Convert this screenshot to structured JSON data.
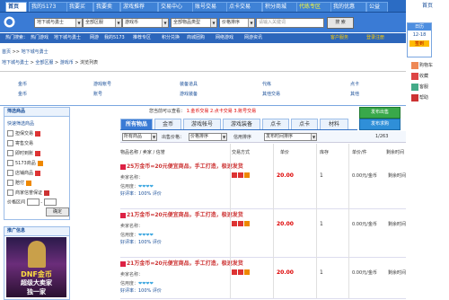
{
  "topnav": {
    "tabs": [
      {
        "label": "首页",
        "active": true
      },
      {
        "label": "我的5173"
      },
      {
        "label": "我要买"
      },
      {
        "label": "我要卖"
      },
      {
        "label": "游戏推荐"
      },
      {
        "label": "交易中心"
      },
      {
        "label": "账号交易"
      },
      {
        "label": "点卡交易"
      },
      {
        "label": "积分商城"
      },
      {
        "label": "代练专区"
      },
      {
        "label": "我的优惠"
      },
      {
        "label": "公益"
      }
    ],
    "right_label": "首页"
  },
  "search": {
    "game": "地下城与勇士",
    "server_type": "全部区服",
    "category": "游戏币",
    "sub_category": "全部物品类型",
    "sort": "价格排序",
    "keyword_placeholder": "请输入关键词",
    "button": "搜 索"
  },
  "sublinks": [
    "热门搜索：",
    "热门游戏",
    "地下城与勇士",
    "网游",
    "我的5173",
    "推荐专区",
    "积分兑换",
    "商城团购",
    "网络游戏",
    "网游资讯",
    "客户服务",
    "登录注册"
  ],
  "rightbar": {
    "calendar_top": "日历",
    "calendar_day": "12-18",
    "calendar_btn": "签到",
    "tools": [
      "购物车",
      "收藏",
      "客服",
      "帮助"
    ]
  },
  "breadcrumb": {
    "line1": [
      "首页",
      "地下城与勇士"
    ],
    "line2": [
      "地下城与勇士",
      "全部区服",
      "游戏币",
      "浏览列表"
    ]
  },
  "categories": [
    [
      "金币",
      "游戏帐号",
      "装备道具",
      "代练",
      "点卡"
    ],
    [
      "金币",
      "账号",
      "游戏装备",
      "其他交易",
      "其他"
    ]
  ],
  "leftpanel": {
    "title": "筛选商品",
    "subtitle": "快速筛选商品",
    "options": [
      "担保交易",
      "寄售交易",
      "即时到账",
      "5173商品",
      "店铺商品",
      "赔付",
      "商家信誉保证"
    ],
    "price_label": "价格区间",
    "price_sep": "-",
    "button": "确定"
  },
  "ad": {
    "title": "推广信息",
    "line1": "DNF金币",
    "line2": "超级大卖家",
    "line3": "独一家"
  },
  "main": {
    "notice_label": "您当前可以查看：",
    "notice_red": [
      "1.金币交易",
      "2.点卡交易",
      "3.账号交易"
    ],
    "publish_buttons": [
      "发布出售",
      "发布求购"
    ],
    "tabs": [
      "所有物品",
      "金币",
      "游戏帐号",
      "游戏装备",
      "点卡",
      "点卡",
      "材料"
    ],
    "filter": {
      "select1": "所有商品",
      "text1": "出售价格：",
      "select2": "价格排序",
      "text2": "信用排序",
      "select3": "发布时间排序",
      "page": "1/263"
    },
    "columns": [
      "物品名称 / 卖家 / 信誉",
      "交易方式",
      "单价",
      "库存",
      "单价/件",
      "剩余时间"
    ]
  },
  "listings": [
    {
      "title": "25万金币=20元便宜商品，手工打造，极速发货",
      "seller": "卖家名称：",
      "credit": "信用度：",
      "stars": "❤❤❤❤",
      "rating": "好评率：100%  评价",
      "price": "20.00",
      "stock": "1",
      "unit": "0.00元/金币",
      "left": "剩余时间"
    },
    {
      "title": "21万金币=20元便宜商品，手工打造，极速发货",
      "seller": "卖家名称：",
      "credit": "信用度：",
      "stars": "❤❤❤❤",
      "rating": "好评率：100%  评价",
      "price": "20.00",
      "stock": "1",
      "unit": "0.00元/金币",
      "left": "剩余时间"
    },
    {
      "title": "21万金币=20元便宜商品，手工打造，极速发货",
      "seller": "卖家名称：",
      "credit": "信用度：",
      "stars": "❤❤❤❤",
      "rating": "好评率：100%  评价",
      "price": "20.00",
      "stock": "1",
      "unit": "0.00元/金币",
      "left": "剩余时间"
    }
  ],
  "colors": {
    "nav": "#2b6cc4",
    "accent_red": "#dd0000",
    "publish_green": "#39a84a"
  }
}
